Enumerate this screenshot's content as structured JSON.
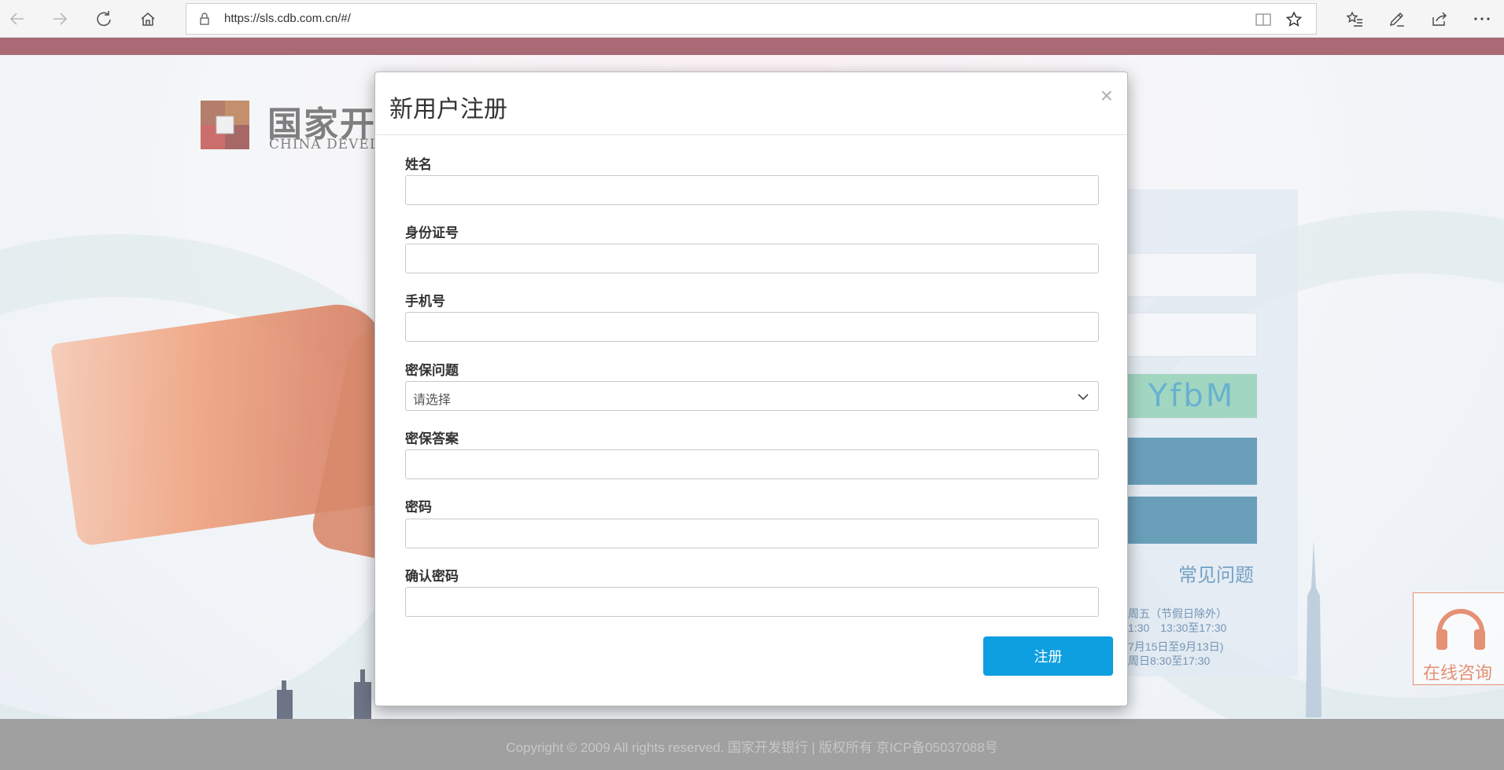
{
  "browser": {
    "url": "https://sls.cdb.com.cn/#/"
  },
  "background_page": {
    "logo_cn": "国家开",
    "logo_en": "CHINA DEVELO",
    "captcha_text": "YfbM",
    "faq_link": "常见问题",
    "hours_lines": [
      "周五（节假日除外）",
      "1:30　13:30至17:30",
      "7月15日至9月13日)",
      "周日8:30至17:30"
    ],
    "consult_label": "在线咨询",
    "footer_text": "Copyright © 2009 All rights reserved. 国家开发银行 | 版权所有 京ICP备05037088号",
    "colors": {
      "top_bar": "#7c1a2c",
      "login_button": "#1b6c95",
      "accent_orange": "#d9552a"
    }
  },
  "modal": {
    "title": "新用户注册",
    "close_symbol": "×",
    "fields": {
      "name": {
        "label": "姓名",
        "value": ""
      },
      "id_number": {
        "label": "身份证号",
        "value": ""
      },
      "phone": {
        "label": "手机号",
        "value": ""
      },
      "security_question": {
        "label": "密保问题",
        "selected": "请选择"
      },
      "security_answer": {
        "label": "密保答案",
        "value": ""
      },
      "password": {
        "label": "密码",
        "value": ""
      },
      "confirm_password": {
        "label": "确认密码",
        "value": ""
      }
    },
    "submit_label": "注册",
    "colors": {
      "submit_button": "#0e9fe0"
    }
  }
}
